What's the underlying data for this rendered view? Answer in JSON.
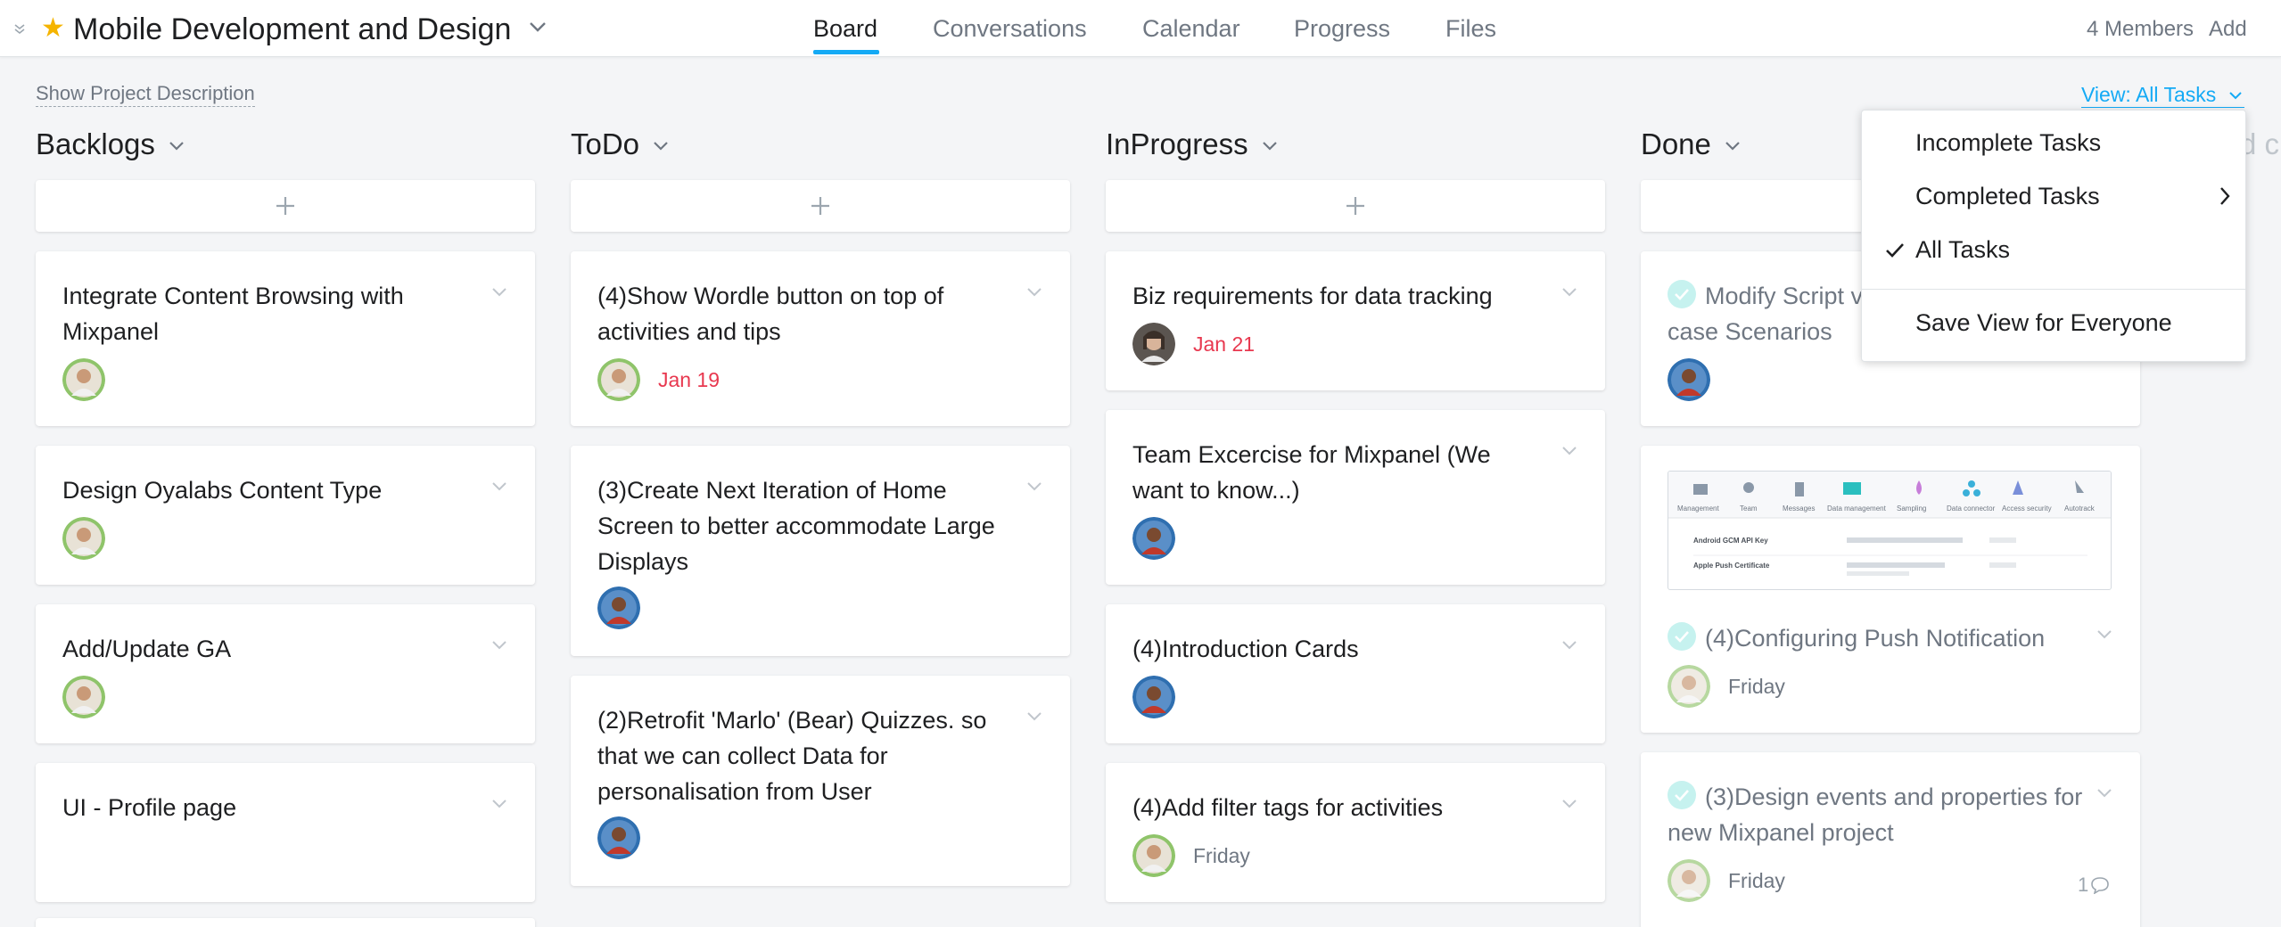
{
  "header": {
    "project_title": "Mobile Development and Design",
    "tabs": [
      {
        "label": "Board",
        "active": true
      },
      {
        "label": "Conversations",
        "active": false
      },
      {
        "label": "Calendar",
        "active": false
      },
      {
        "label": "Progress",
        "active": false
      },
      {
        "label": "Files",
        "active": false
      }
    ],
    "members": "4 Members",
    "add": "Add"
  },
  "toolbar": {
    "show_description": "Show Project Description",
    "view_filter": "View: All Tasks"
  },
  "columns": [
    {
      "title": "Backlogs",
      "cards": [
        {
          "title": "Integrate Content Browsing with Mixpanel",
          "due": ""
        },
        {
          "title": "Design Oyalabs Content Type",
          "due": ""
        },
        {
          "title": "Add/Update GA",
          "due": ""
        },
        {
          "title": "UI - Profile page",
          "due": ""
        }
      ]
    },
    {
      "title": "ToDo",
      "cards": [
        {
          "title": "(4)Show Wordle button on top of activities and tips",
          "due": "Jan 19"
        },
        {
          "title": "(3)Create Next Iteration of Home Screen to better accommodate Large Displays",
          "due": ""
        },
        {
          "title": "(2)Retrofit 'Marlo' (Bear) Quizzes. so that we can collect Data for personalisation from User",
          "due": ""
        }
      ]
    },
    {
      "title": "InProgress",
      "cards": [
        {
          "title": "Biz requirements for data tracking",
          "due": "Jan 21"
        },
        {
          "title": "Team Excercise for Mixpanel (We want to know...)",
          "due": ""
        },
        {
          "title": "(4)Introduction Cards",
          "due": ""
        },
        {
          "title": "(4)Add filter tags for activities",
          "due": "Friday"
        }
      ]
    },
    {
      "title": "Done",
      "cards": [
        {
          "title": "Modify Script v",
          "title_line2": "case Scenarios",
          "due": ""
        },
        {
          "title": "(4)Configuring Push Notification",
          "due": "Friday"
        },
        {
          "title": "(3)Design events and properties for new Mixpanel project",
          "due": "Friday",
          "comments": "1"
        }
      ]
    }
  ],
  "ghost_column_title": "d c",
  "view_menu": {
    "items": [
      "Incomplete Tasks",
      "Completed Tasks",
      "All Tasks",
      "Save View for Everyone"
    ],
    "selected": "All Tasks"
  },
  "thumbnail_labels": [
    "Management",
    "Team",
    "Messages",
    "Data management",
    "Sampling",
    "Data connector",
    "Access security",
    "Autotrack"
  ],
  "thumbnail_rows": [
    {
      "key": "Android GCM API Key"
    },
    {
      "key": "Apple Push Certificate"
    }
  ],
  "colors": {
    "accent": "#14aaf5",
    "star": "#f5b400",
    "due_red": "#e8384f",
    "complete_check": "#c6f2ef"
  }
}
